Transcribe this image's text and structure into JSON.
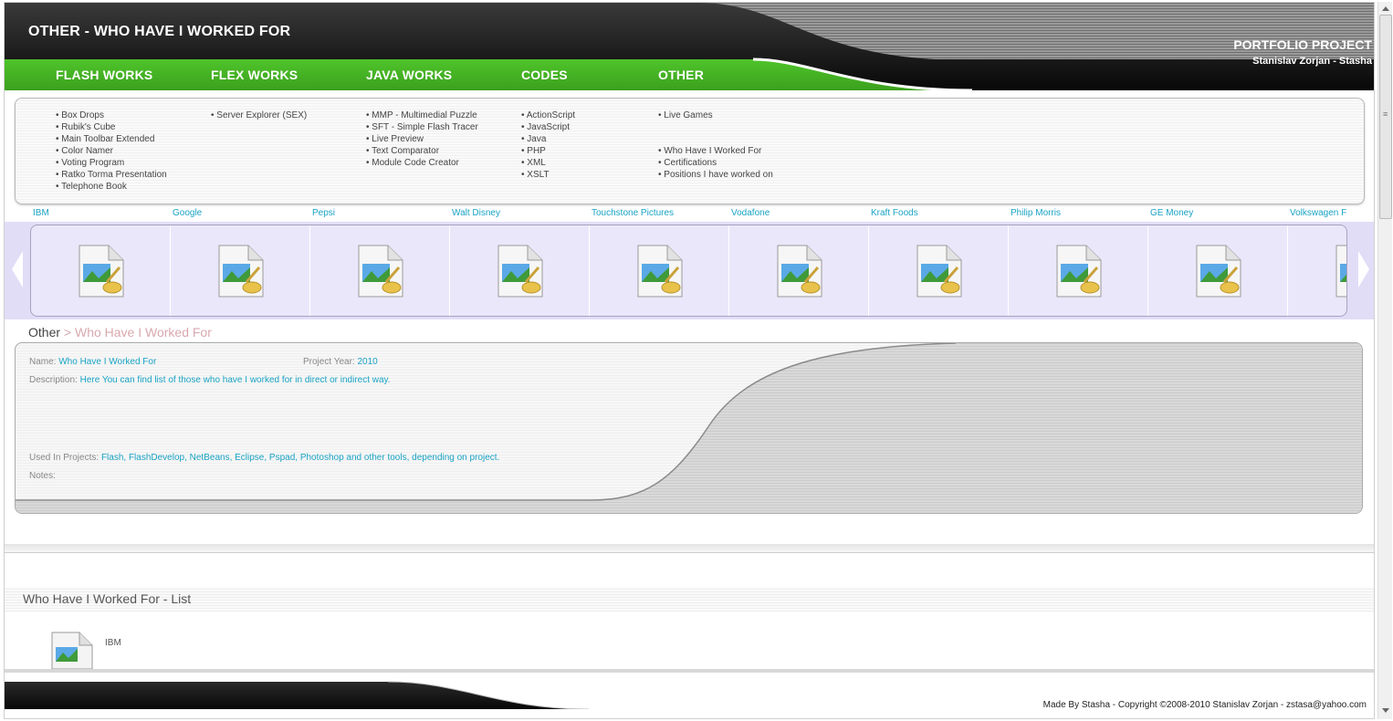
{
  "header": {
    "page_title": "OTHER - WHO HAVE I WORKED FOR",
    "brand": "PORTFOLIO PROJECT",
    "author": "Stanislav Zorjan - Stasha",
    "colors": {
      "nav_green": "#44b523",
      "dark": "#101010",
      "accent": "#1aa3c4"
    }
  },
  "nav": [
    {
      "label": "FLASH WORKS"
    },
    {
      "label": "FLEX WORKS"
    },
    {
      "label": "JAVA WORKS"
    },
    {
      "label": "CODES"
    },
    {
      "label": "OTHER"
    }
  ],
  "menu": {
    "flash": [
      "Box Drops",
      "Rubik's Cube",
      "Main Toolbar Extended",
      "Color Namer",
      "Voting Program",
      "Ratko Torma Presentation",
      "Telephone Book"
    ],
    "flex": [
      "Server Explorer (SEX)"
    ],
    "java": [
      "MMP - Multimedial Puzzle",
      "SFT - Simple Flash Tracer",
      "Live Preview",
      "Text Comparator",
      "Module Code Creator"
    ],
    "codes": [
      "ActionScript",
      "JavaScript",
      "Java",
      "PHP",
      "XML",
      "XSLT"
    ],
    "other_top": [
      "Live Games"
    ],
    "other_bottom": [
      "Who Have I Worked For",
      "Certifications",
      "Positions I have worked on"
    ]
  },
  "carousel": {
    "labels": [
      "IBM",
      "Google",
      "Pepsi",
      "Walt Disney",
      "Touchstone Pictures",
      "Vodafone",
      "Kraft Foods",
      "Philip Morris",
      "GE Money",
      "Volkswagen F"
    ],
    "item_icon": "image-file-icon",
    "prev_icon": "arrow-left-icon",
    "next_icon": "arrow-right-icon"
  },
  "breadcrumb": {
    "parent": "Other",
    "separator": " > ",
    "current": "Who Have I Worked For"
  },
  "details": {
    "name_label": "Name:",
    "name_value": "Who Have I Worked For",
    "year_label": "Project Year:",
    "year_value": "2010",
    "desc_label": "Description:",
    "desc_value": "Here You can find list of those who have I worked for in direct or indirect way.",
    "used_label": "Used In Projects:",
    "used_value": "Flash, FlashDevelop, NetBeans, Eclipse, Pspad, Photoshop and other tools, depending on project.",
    "notes_label": "Notes:",
    "notes_value": ""
  },
  "list": {
    "title": "Who Have I Worked For - List",
    "items": [
      {
        "label": "IBM",
        "icon": "image-file-icon"
      }
    ]
  },
  "footer": {
    "copyright": "Made By Stasha - Copyright ©2008-2010 Stanislav Zorjan - zstasa@yahoo.com"
  }
}
